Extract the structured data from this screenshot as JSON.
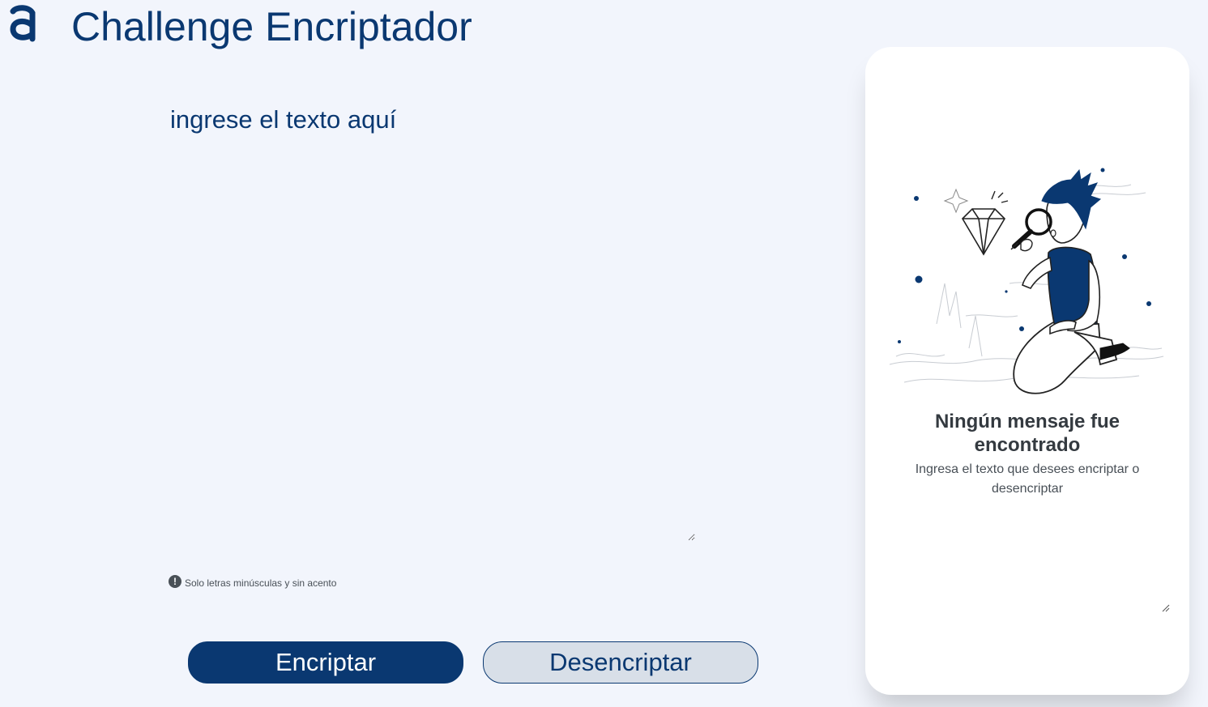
{
  "header": {
    "title": "Challenge Encriptador",
    "logo_icon": "alura-logo-icon"
  },
  "input": {
    "placeholder": "ingrese el texto aquí",
    "value": ""
  },
  "hint": {
    "icon": "exclamation-circle-icon",
    "text": "Solo letras minúsculas y sin acento"
  },
  "buttons": {
    "encrypt_label": "Encriptar",
    "decrypt_label": "Desencriptar"
  },
  "output": {
    "illustration": "person-with-magnifier-illustration",
    "empty_title": "Ningún mensaje fue encontrado",
    "empty_subtitle": "Ingresa el texto que desees encriptar o desencriptar"
  },
  "colors": {
    "background": "#F2F5FC",
    "primary": "#0A3871",
    "secondary_button": "#D8DFE8",
    "card": "#FFFFFF",
    "text_dark": "#343A40",
    "text_muted": "#495057"
  }
}
